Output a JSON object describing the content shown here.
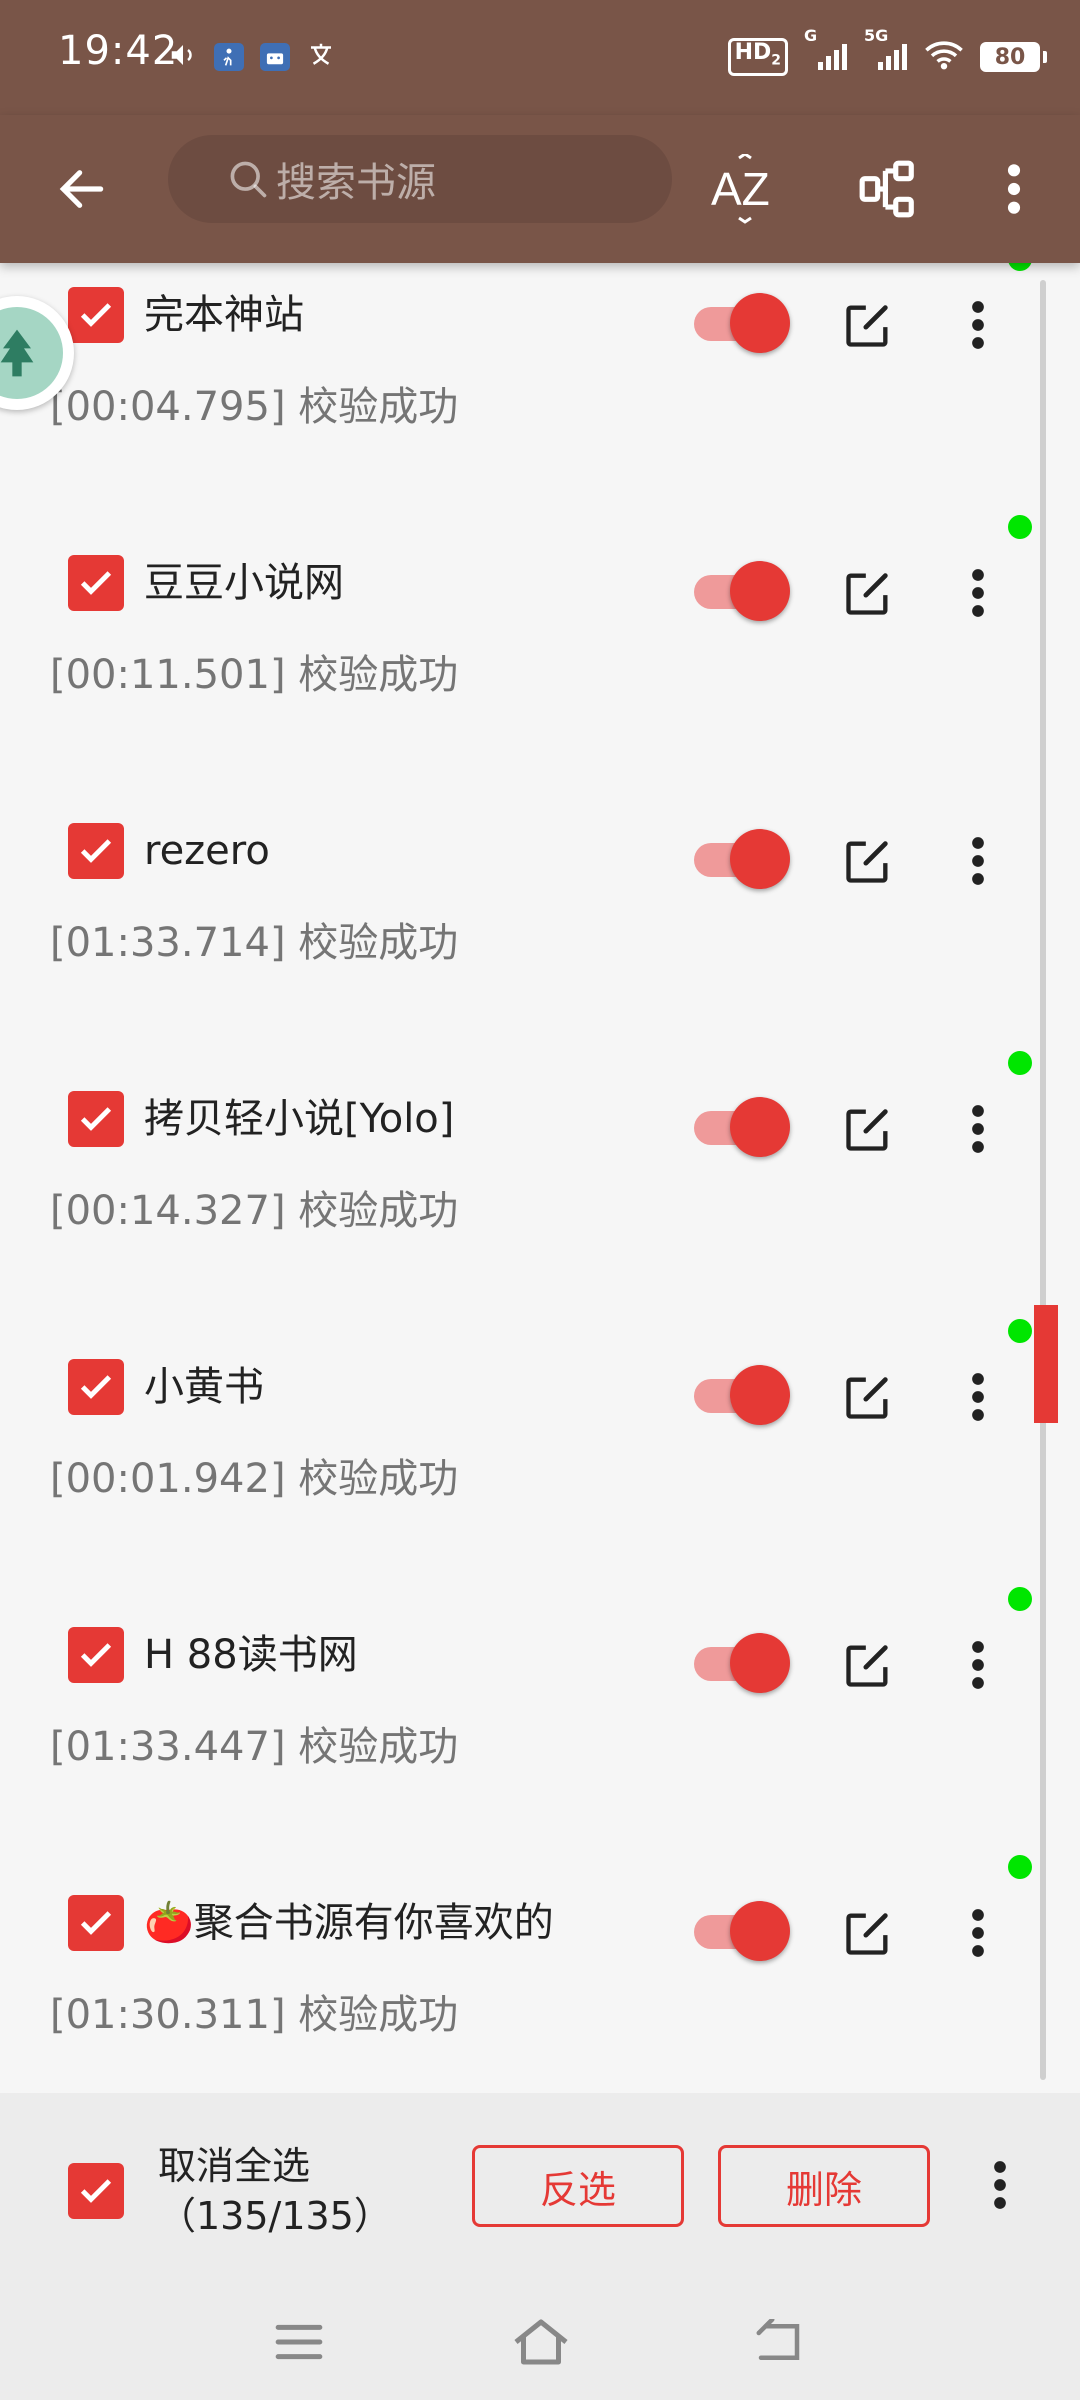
{
  "status_bar": {
    "time": "19:42",
    "hd_label": "HD",
    "hd_sub": "2",
    "signal_1_label": "G",
    "signal_2_label": "5G",
    "battery": "80"
  },
  "toolbar": {
    "search_placeholder": "搜索书源",
    "sort_label": "AZ"
  },
  "sources": [
    {
      "name": "完本神站",
      "status": "[00:04.795] 校验成功",
      "enabled": true,
      "checked": true,
      "has_dot": true
    },
    {
      "name": "豆豆小说网",
      "status": "[00:11.501] 校验成功",
      "enabled": true,
      "checked": true,
      "has_dot": true
    },
    {
      "name": "rezero",
      "status": "[01:33.714] 校验成功",
      "enabled": true,
      "checked": true,
      "has_dot": false
    },
    {
      "name": "拷贝轻小说[Yolo]",
      "status": "[00:14.327] 校验成功",
      "enabled": true,
      "checked": true,
      "has_dot": true
    },
    {
      "name": "小黄书",
      "status": "[00:01.942] 校验成功",
      "enabled": true,
      "checked": true,
      "has_dot": true
    },
    {
      "name": "H 88读书网",
      "status": "[01:33.447] 校验成功",
      "enabled": true,
      "checked": true,
      "has_dot": true
    },
    {
      "name": "🍅聚合书源有你喜欢的",
      "status": "[01:30.311] 校验成功",
      "enabled": true,
      "checked": true,
      "has_dot": true
    }
  ],
  "selection_bar": {
    "select_all_label": "取消全选",
    "count_label": "（135/135）",
    "invert_label": "反选",
    "delete_label": "删除"
  },
  "icons": {
    "back": "arrow-left-icon",
    "search": "search-icon",
    "sort": "sort-az-icon",
    "group": "group-icon",
    "menu": "more-vert-icon",
    "edit": "edit-icon",
    "nav_menu": "menu-icon",
    "nav_home": "home-icon",
    "nav_back": "back-icon"
  },
  "colors": {
    "primary": "#795548",
    "accent": "#e53935",
    "accent_light": "#ef9a9a",
    "indicator": "#00e600"
  }
}
